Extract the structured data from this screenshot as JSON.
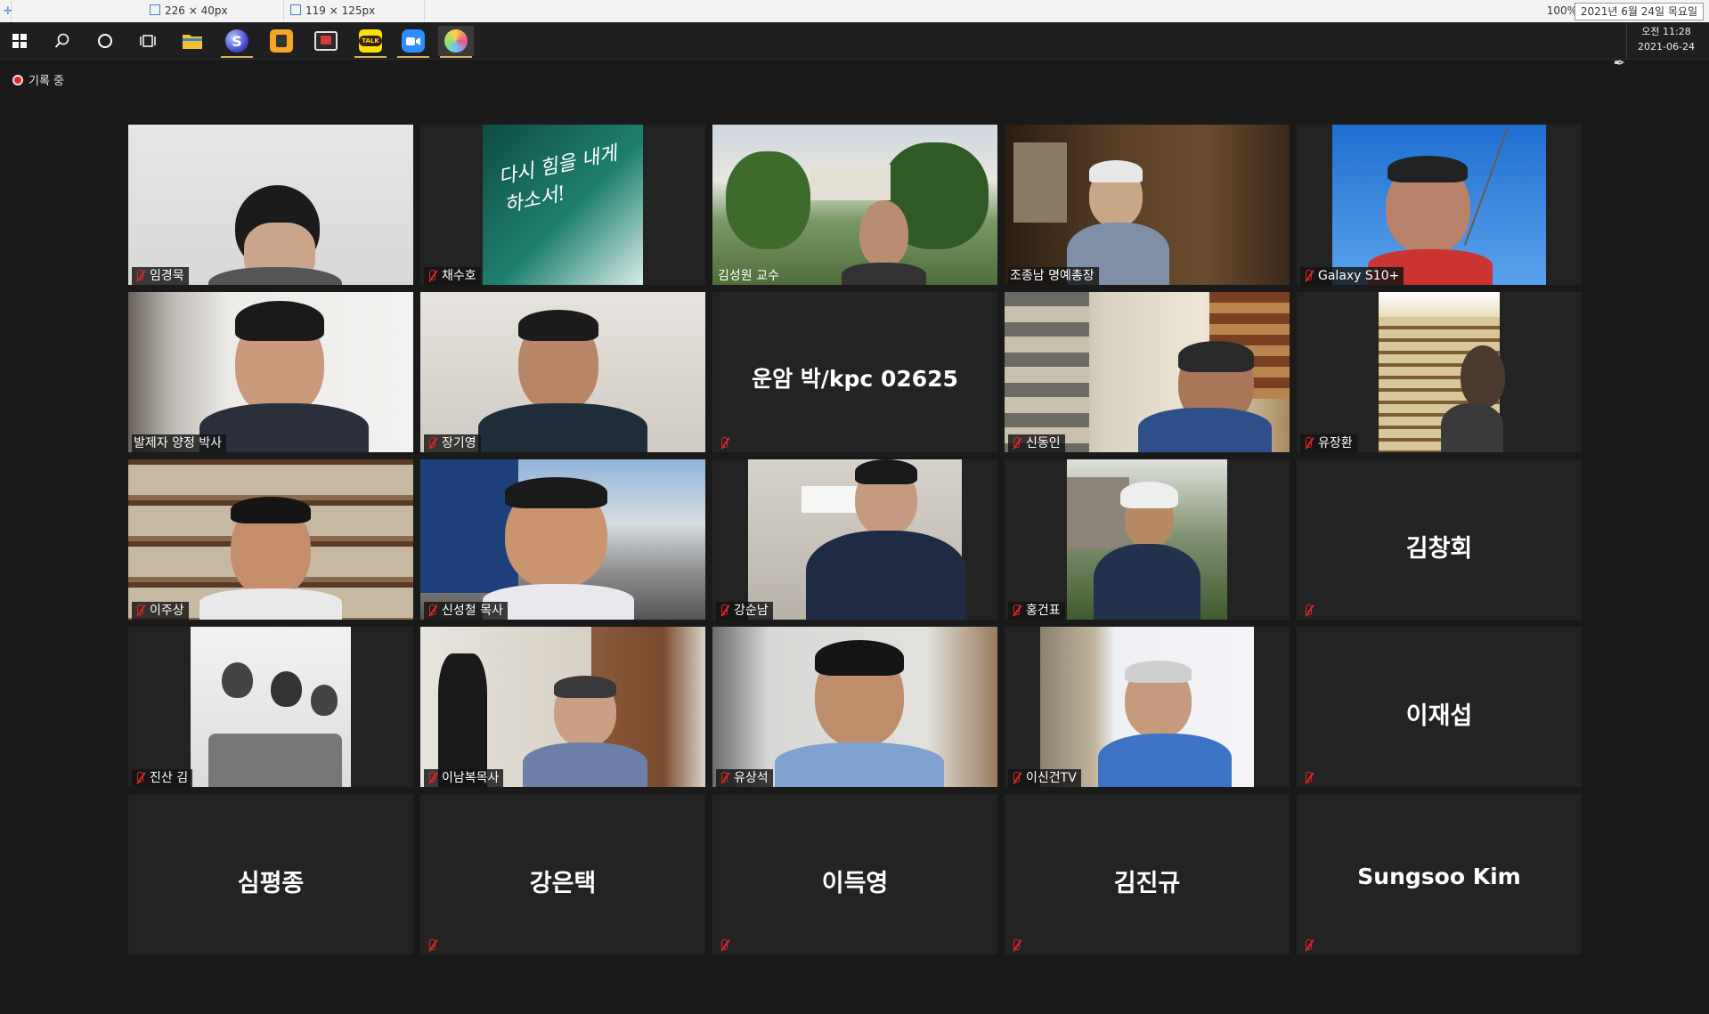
{
  "topbar": {
    "size1": "226 × 40px",
    "size2": "119 × 125px",
    "zoom": "100%",
    "date": "2021년 6월 24일 목요일"
  },
  "taskbar": {
    "apps": [
      "windows-start-icon",
      "search-icon",
      "cortana-icon",
      "task-view-icon",
      "file-explorer-icon",
      "browser-s-icon",
      "app-orange-icon",
      "app-film-icon",
      "kakaotalk-icon",
      "zoom-icon",
      "app-palette-icon"
    ],
    "kakao_text": "TALK",
    "clock_time": "오전 11:28",
    "clock_date": "2021-06-24"
  },
  "recording": {
    "label": "기록 중",
    "color": "#e0262b"
  },
  "meeting": {
    "speaker_color": "#c7e33a",
    "participants": [
      {
        "name": "임경묵",
        "video": true
      },
      {
        "name": "채수호",
        "video": true,
        "overlay_text": "다시 힘을 내게 하소서!"
      },
      {
        "name": "김성원 교수",
        "video": true
      },
      {
        "name": "조종남 명예총장",
        "video": true
      },
      {
        "name": "Galaxy S10+",
        "video": true
      },
      {
        "name": "발제자 양정 박사",
        "video": true,
        "speaking": true
      },
      {
        "name": "장기영",
        "video": true
      },
      {
        "name": "운암 박/kpc 02625",
        "video": false
      },
      {
        "name": "신동인",
        "video": true
      },
      {
        "name": "유장환",
        "video": true
      },
      {
        "name": "이주상",
        "video": true
      },
      {
        "name": "신성철 목사",
        "video": true
      },
      {
        "name": "강순남",
        "video": true
      },
      {
        "name": "홍건표",
        "video": true
      },
      {
        "name": "김창회",
        "video": false
      },
      {
        "name": "진산 김",
        "video": true
      },
      {
        "name": "이남복목사",
        "video": true
      },
      {
        "name": "유상석",
        "video": true
      },
      {
        "name": "이신건TV",
        "video": true
      },
      {
        "name": "이재섭",
        "video": false
      },
      {
        "name": "심평종",
        "video": false
      },
      {
        "name": "강은택",
        "video": false
      },
      {
        "name": "이득영",
        "video": false
      },
      {
        "name": "김진규",
        "video": false
      },
      {
        "name": "Sungsoo Kim",
        "video": false
      }
    ]
  }
}
